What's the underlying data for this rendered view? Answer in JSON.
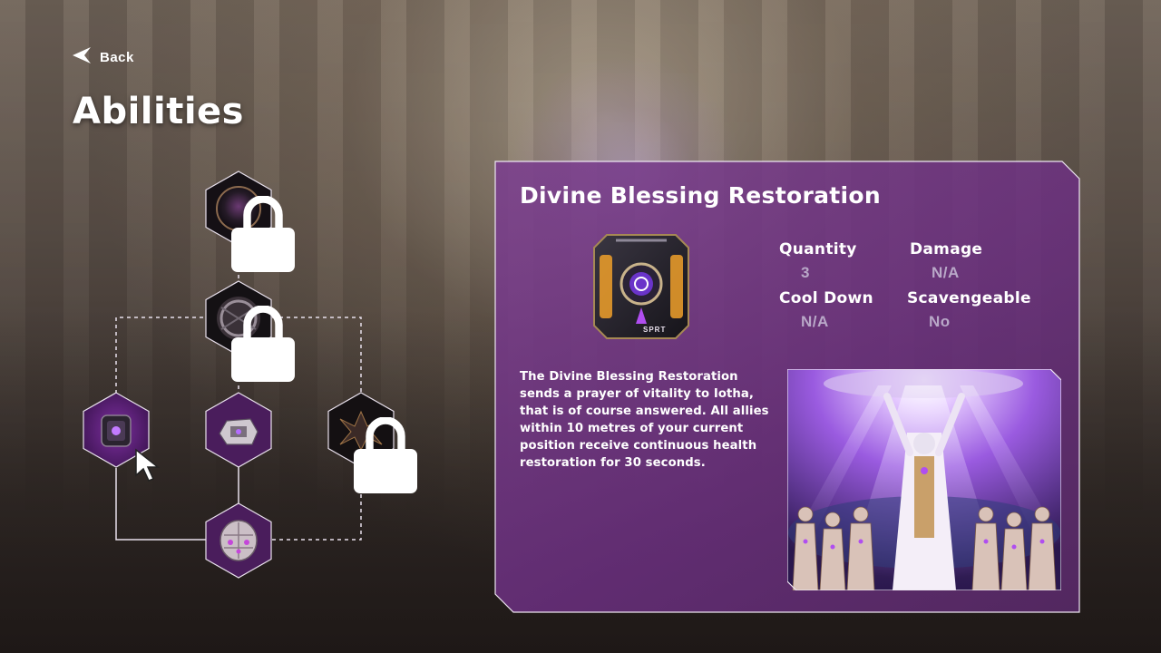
{
  "nav": {
    "back_label": "Back"
  },
  "page": {
    "title": "Abilities"
  },
  "tree": {
    "nodes": [
      {
        "id": "top",
        "state": "locked"
      },
      {
        "id": "upper",
        "state": "locked"
      },
      {
        "id": "left",
        "state": "selected"
      },
      {
        "id": "middle",
        "state": "unlocked"
      },
      {
        "id": "right",
        "state": "locked"
      },
      {
        "id": "bottom",
        "state": "unlocked"
      }
    ]
  },
  "details": {
    "title": "Divine Blessing Restoration",
    "stats": {
      "quantity_label": "Quantity",
      "quantity_value": "3",
      "damage_label": "Damage",
      "damage_value": "N/A",
      "cooldown_label": "Cool Down",
      "cooldown_value": "N/A",
      "scavengeable_label": "Scavengeable",
      "scavengeable_value": "No"
    },
    "description": "The Divine Blessing Restoration sends a prayer of vitality to Iotha, that is of course answered. All allies within 10 metres of your current position receive continuous health restoration for 30 seconds.",
    "item_badge": "SPRT"
  },
  "colors": {
    "panel_purple": "#7a3c8f",
    "accent_violet": "#a455e0",
    "stat_value": "#b9a8c8"
  }
}
